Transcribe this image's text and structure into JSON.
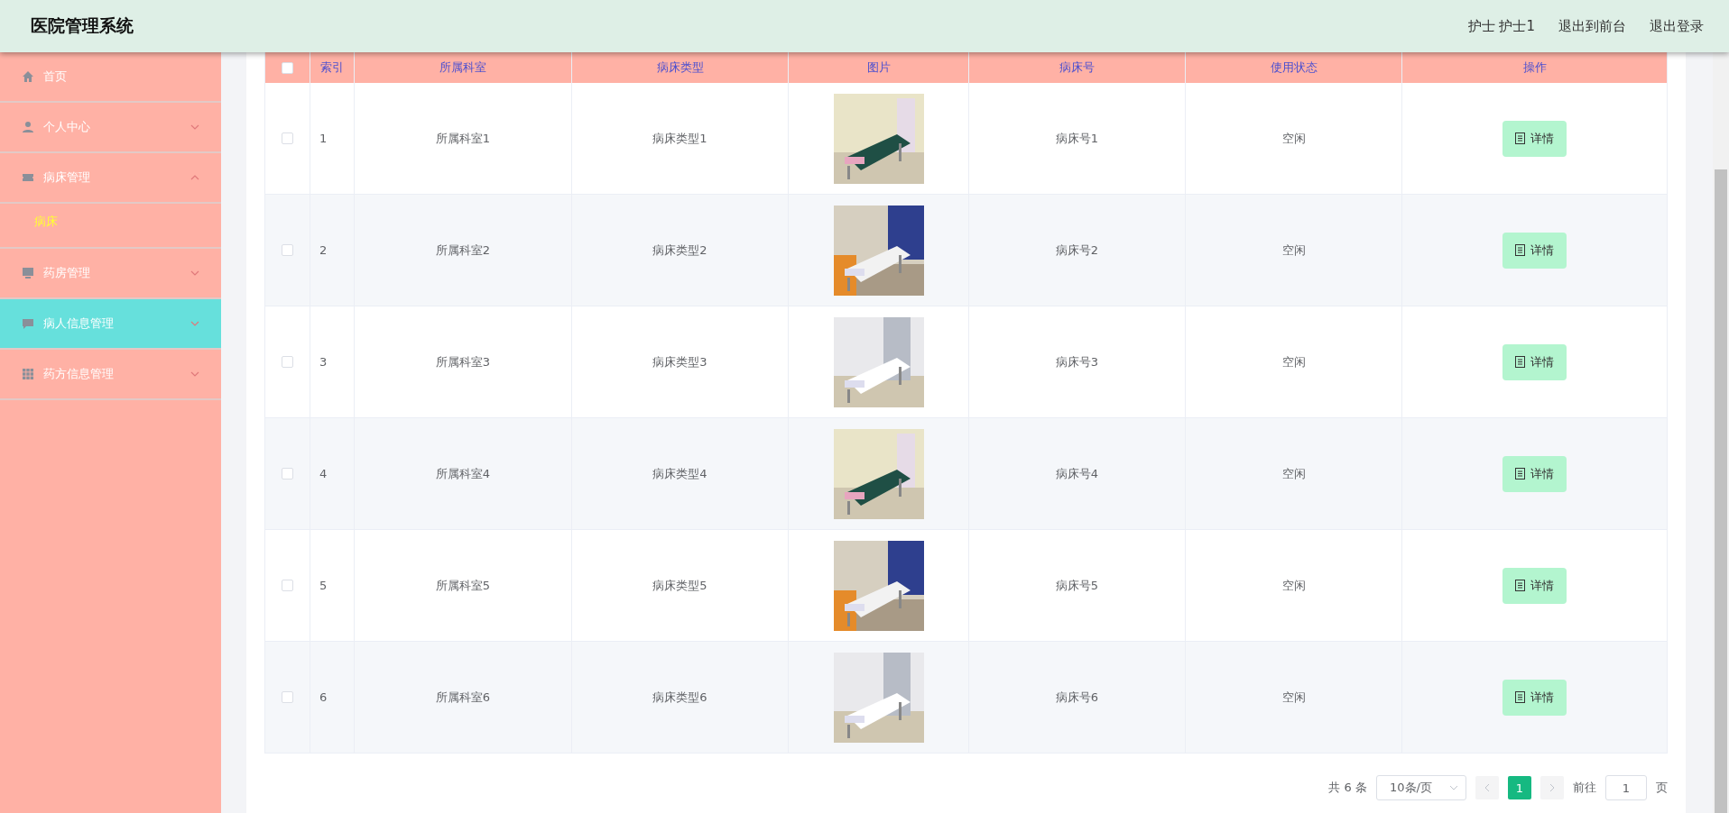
{
  "header": {
    "title": "医院管理系统",
    "links": [
      "护士 护士1",
      "退出到前台",
      "退出登录"
    ]
  },
  "sidebar": {
    "items": [
      {
        "kind": "link",
        "label": "首页",
        "highlighted": false
      },
      {
        "kind": "submenu",
        "label": "个人中心",
        "expanded": false,
        "highlighted": false
      },
      {
        "kind": "submenu",
        "label": "病床管理",
        "expanded": true,
        "highlighted": false,
        "children": [
          {
            "label": "病床",
            "selected": true
          }
        ]
      },
      {
        "kind": "submenu",
        "label": "药房管理",
        "expanded": false,
        "highlighted": false
      },
      {
        "kind": "submenu",
        "label": "病人信息管理",
        "expanded": false,
        "highlighted": true
      },
      {
        "kind": "submenu",
        "label": "药方信息管理",
        "expanded": false,
        "highlighted": false
      }
    ]
  },
  "table": {
    "all_checked": false,
    "columns": [
      "索引",
      "所属科室",
      "病床类型",
      "图片",
      "病床号",
      "使用状态",
      "操作"
    ],
    "rows": [
      {
        "checked": false,
        "index": "1",
        "department": "所属科室1",
        "bed_type": "病床类型1",
        "bed_no": "病床号1",
        "status": "空闲",
        "action": "详情"
      },
      {
        "checked": false,
        "index": "2",
        "department": "所属科室2",
        "bed_type": "病床类型2",
        "bed_no": "病床号2",
        "status": "空闲",
        "action": "详情"
      },
      {
        "checked": false,
        "index": "3",
        "department": "所属科室3",
        "bed_type": "病床类型3",
        "bed_no": "病床号3",
        "status": "空闲",
        "action": "详情"
      },
      {
        "checked": false,
        "index": "4",
        "department": "所属科室4",
        "bed_type": "病床类型4",
        "bed_no": "病床号4",
        "status": "空闲",
        "action": "详情"
      },
      {
        "checked": false,
        "index": "5",
        "department": "所属科室5",
        "bed_type": "病床类型5",
        "bed_no": "病床号5",
        "status": "空闲",
        "action": "详情"
      },
      {
        "checked": false,
        "index": "6",
        "department": "所属科室6",
        "bed_type": "病床类型6",
        "bed_no": "病床号6",
        "status": "空闲",
        "action": "详情"
      }
    ]
  },
  "pagination": {
    "total": "共 6 条",
    "page_size": "10条/页",
    "pages": [
      {
        "label": "1",
        "selected": true
      }
    ],
    "goto_label": "前往",
    "goto_value": "1",
    "goto_suffix": "页"
  }
}
